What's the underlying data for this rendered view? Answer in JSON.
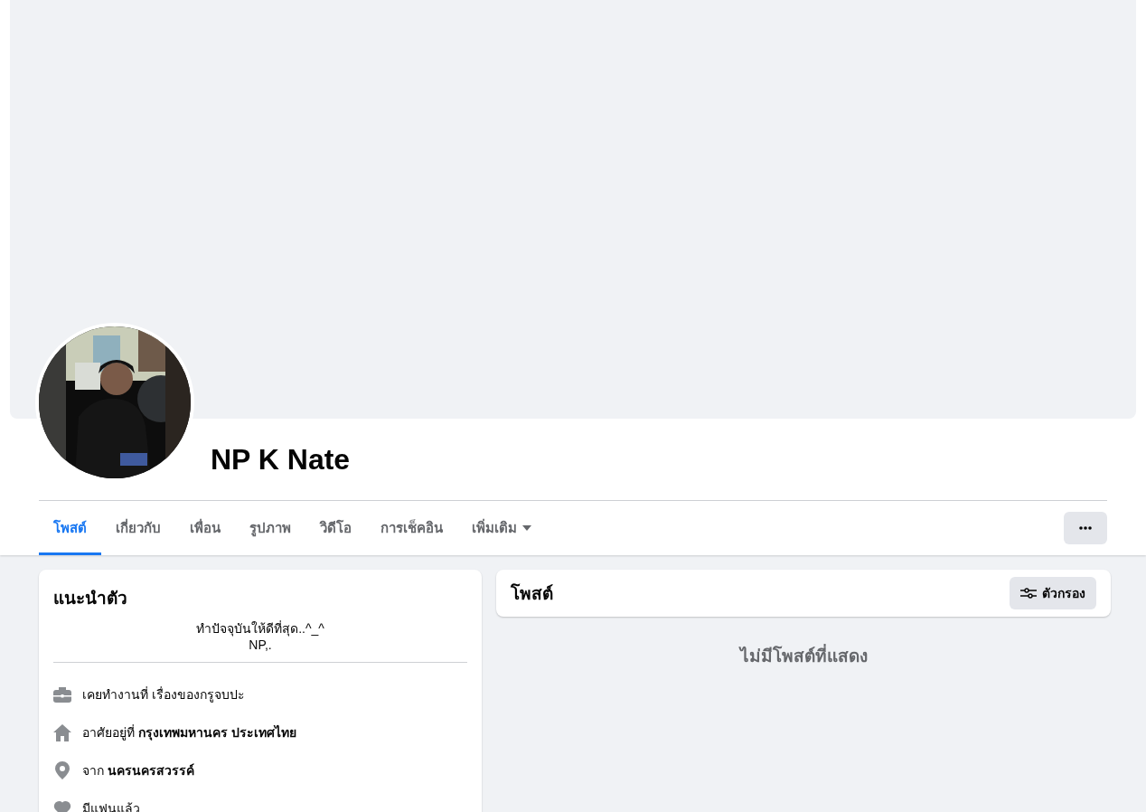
{
  "profile": {
    "name": "NP K Nate"
  },
  "tabs": [
    {
      "label": "โพสต์",
      "selected": true,
      "dropdown": false
    },
    {
      "label": "เกี่ยวกับ",
      "selected": false,
      "dropdown": false
    },
    {
      "label": "เพื่อน",
      "selected": false,
      "dropdown": false
    },
    {
      "label": "รูปภาพ",
      "selected": false,
      "dropdown": false
    },
    {
      "label": "วิดีโอ",
      "selected": false,
      "dropdown": false
    },
    {
      "label": "การเช็คอิน",
      "selected": false,
      "dropdown": false
    },
    {
      "label": "เพิ่มเติม",
      "selected": false,
      "dropdown": true
    }
  ],
  "intro": {
    "title": "แนะนำตัว",
    "bio": [
      "ทำปัจจุบันให้ดีที่สุด..^_^",
      "NP,."
    ],
    "items": [
      {
        "kind": "work",
        "text": "เคยทำงานที่ เรื่องของกรูจบปะ"
      },
      {
        "kind": "home",
        "text": "อาศัยอยู่ที่ **กรุงเทพมหานคร ประเทศไทย**"
      },
      {
        "kind": "location",
        "text": "จาก **นครนครสวรรค์**"
      },
      {
        "kind": "relationship",
        "text": "มีแฟนแล้ว"
      }
    ]
  },
  "posts": {
    "title": "โพสต์",
    "filter_button": "ตัวกรอง",
    "empty_message": "ไม่มีโพสต์ที่แสดง"
  }
}
